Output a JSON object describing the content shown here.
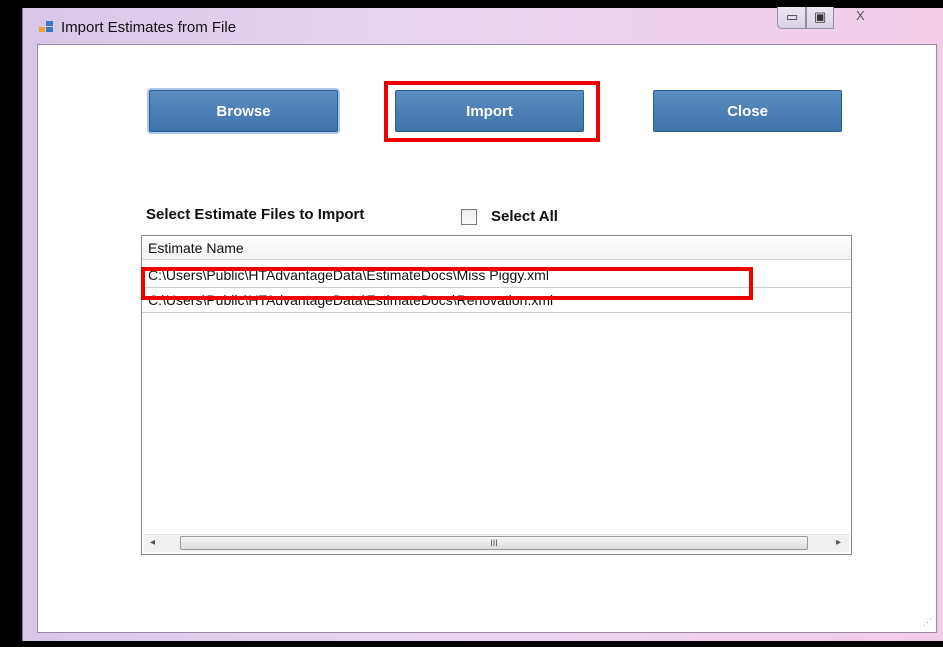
{
  "window": {
    "title": "Import Estimates from File",
    "controls": {
      "minimize": "▭",
      "maximize": "▣",
      "close": "X"
    }
  },
  "toolbar": {
    "browse_label": "Browse",
    "import_label": "Import",
    "close_label": "Close"
  },
  "selection": {
    "label": "Select Estimate Files to Import",
    "select_all_label": "Select All",
    "select_all_checked": false
  },
  "list": {
    "column_header": "Estimate Name",
    "rows": [
      "C:\\Users\\Public\\HTAdvantageData\\EstimateDocs\\Miss Piggy.xml",
      "C:\\Users\\Public\\HTAdvantageData\\EstimateDocs\\Renovation.xml"
    ]
  },
  "scrollbar": {
    "left_arrow": "◂",
    "right_arrow": "▸",
    "thumb_grip": "III"
  },
  "colors": {
    "button": "#4a7fb5",
    "highlight": "#ee0000",
    "frame": "#e6d3ee"
  }
}
